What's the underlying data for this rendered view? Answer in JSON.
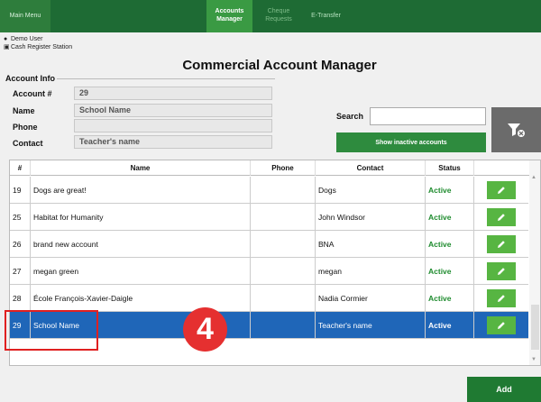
{
  "topbar": {
    "main_menu": "Main Menu",
    "accounts_manager": "Accounts\nManager",
    "cheque_requests": "Cheque\nRequests",
    "etransfer": "E-Transfer"
  },
  "user": {
    "name": "Demo User",
    "station": "Cash Register Station"
  },
  "page_title": "Commercial Account Manager",
  "account_info": {
    "legend": "Account Info",
    "account_label": "Account #",
    "account_value": "29",
    "name_label": "Name",
    "name_value": "School Name",
    "phone_label": "Phone",
    "phone_value": "",
    "contact_label": "Contact",
    "contact_value": "Teacher's name"
  },
  "search": {
    "label": "Search",
    "value": ""
  },
  "show_inactive_label": "Show inactive accounts",
  "table": {
    "headers": [
      "#",
      "Name",
      "Phone",
      "Contact",
      "Status"
    ],
    "rows": [
      {
        "num": "19",
        "name": "Dogs are great!",
        "phone": "",
        "contact": "Dogs",
        "status": "Active"
      },
      {
        "num": "25",
        "name": "Habitat for Humanity",
        "phone": "",
        "contact": "John Windsor",
        "status": "Active"
      },
      {
        "num": "26",
        "name": "brand new account",
        "phone": "",
        "contact": "BNA",
        "status": "Active"
      },
      {
        "num": "27",
        "name": "megan green",
        "phone": "",
        "contact": "megan",
        "status": "Active"
      },
      {
        "num": "28",
        "name": "École François-Xavier-Daigle",
        "phone": "",
        "contact": "Nadia Cormier",
        "status": "Active"
      },
      {
        "num": "29",
        "name": "School Name",
        "phone": "",
        "contact": "Teacher's name",
        "status": "Active"
      }
    ]
  },
  "annotation_number": "4",
  "add_label": "Add",
  "colors": {
    "topbar": "#1e6b34",
    "accent_green": "#2e8b3e",
    "selected_row": "#1f66b8",
    "annotation_red": "#e53030"
  }
}
